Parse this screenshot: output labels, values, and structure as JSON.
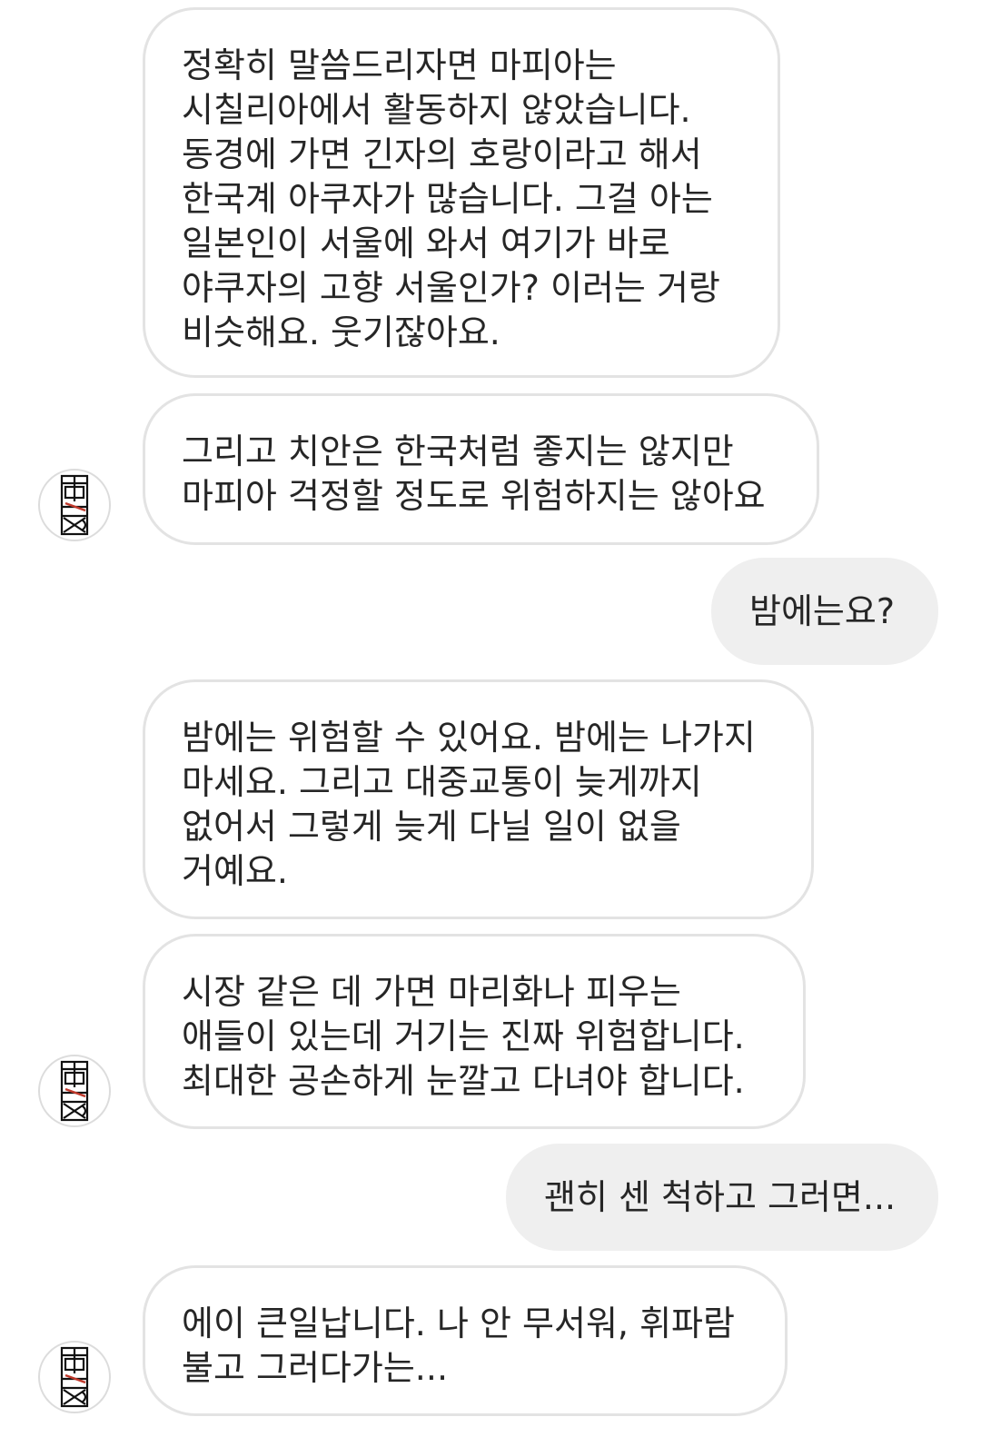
{
  "messages": [
    {
      "sender": "other",
      "text": "정확히 말씀드리자면 마피아는\n시칠리아에서 활동하지 않았습니다.\n동경에 가면 긴자의 호랑이라고 해서\n한국계 아쿠자가 많습니다. 그걸 아는\n일본인이 서울에 와서 여기가 바로\n야쿠자의 고향 서울인가? 이러는 거랑\n비슷해요. 웃기잖아요."
    },
    {
      "sender": "other",
      "text": "그리고 치안은 한국처럼 좋지는 않지만\n마피아 걱정할 정도로 위험하지는 않아요"
    },
    {
      "sender": "me",
      "text": "밤에는요?"
    },
    {
      "sender": "other",
      "text": "밤에는 위험할 수 있어요. 밤에는 나가지\n마세요. 그리고 대중교통이 늦게까지\n없어서 그렇게 늦게 다닐 일이 없을\n거예요."
    },
    {
      "sender": "other",
      "text": "시장 같은 데 가면 마리화나 피우는\n애들이 있는데 거기는 진짜 위험합니다.\n최대한 공손하게 눈깔고 다녀야 합니다."
    },
    {
      "sender": "me",
      "text": "괜히 센 척하고 그러면..."
    },
    {
      "sender": "other",
      "text": "에이 큰일납니다. 나 안 무서워, 휘파람\n불고 그러다가는..."
    }
  ],
  "colors": {
    "incoming_border": "#e3e3e3",
    "outgoing_bg": "#efefef",
    "text": "#262626",
    "avatar_accent": "#c0392b"
  }
}
